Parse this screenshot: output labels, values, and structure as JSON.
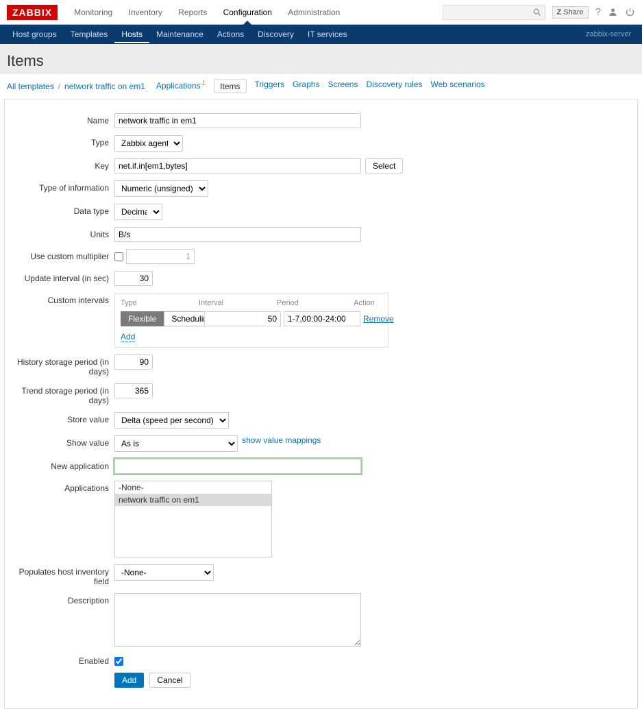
{
  "logo": "ZABBIX",
  "topnav": {
    "monitoring": "Monitoring",
    "inventory": "Inventory",
    "reports": "Reports",
    "configuration": "Configuration",
    "administration": "Administration"
  },
  "share": "Share",
  "subnav": {
    "host_groups": "Host groups",
    "templates": "Templates",
    "hosts": "Hosts",
    "maintenance": "Maintenance",
    "actions": "Actions",
    "discovery": "Discovery",
    "it_services": "IT services"
  },
  "server": "zabbix-server",
  "page_title": "Items",
  "breadcrumb": {
    "all_templates": "All templates",
    "template": "network traffic on em1"
  },
  "tabs": {
    "applications": "Applications",
    "applications_count": "1",
    "items": "Items",
    "triggers": "Triggers",
    "graphs": "Graphs",
    "screens": "Screens",
    "discovery_rules": "Discovery rules",
    "web_scenarios": "Web scenarios"
  },
  "labels": {
    "name": "Name",
    "type": "Type",
    "key": "Key",
    "select": "Select",
    "type_of_info": "Type of information",
    "data_type": "Data type",
    "units": "Units",
    "use_custom_multiplier": "Use custom multiplier",
    "update_interval": "Update interval (in sec)",
    "custom_intervals": "Custom intervals",
    "ci_type": "Type",
    "ci_interval": "Interval",
    "ci_period": "Period",
    "ci_action": "Action",
    "flexible": "Flexible",
    "scheduling": "Scheduling",
    "remove": "Remove",
    "add_link": "Add",
    "history_period": "History storage period (in days)",
    "trend_period": "Trend storage period (in days)",
    "store_value": "Store value",
    "show_value": "Show value",
    "show_value_mappings": "show value mappings",
    "new_application": "New application",
    "applications": "Applications",
    "populates": "Populates host inventory field",
    "description": "Description",
    "enabled": "Enabled",
    "add_btn": "Add",
    "cancel_btn": "Cancel"
  },
  "values": {
    "name": "network traffic in em1",
    "type": "Zabbix agent",
    "key": "net.if.in[em1,bytes]",
    "type_of_info": "Numeric (unsigned)",
    "data_type": "Decimal",
    "units": "B/s",
    "multiplier": "1",
    "update_interval": "30",
    "ci_interval": "50",
    "ci_period": "1-7,00:00-24:00",
    "history_period": "90",
    "trend_period": "365",
    "store_value": "Delta (speed per second)",
    "show_value": "As is",
    "new_application": "",
    "populates": "-None-",
    "description": ""
  },
  "app_options": {
    "none": "-None-",
    "sel": "network traffic on em1"
  }
}
